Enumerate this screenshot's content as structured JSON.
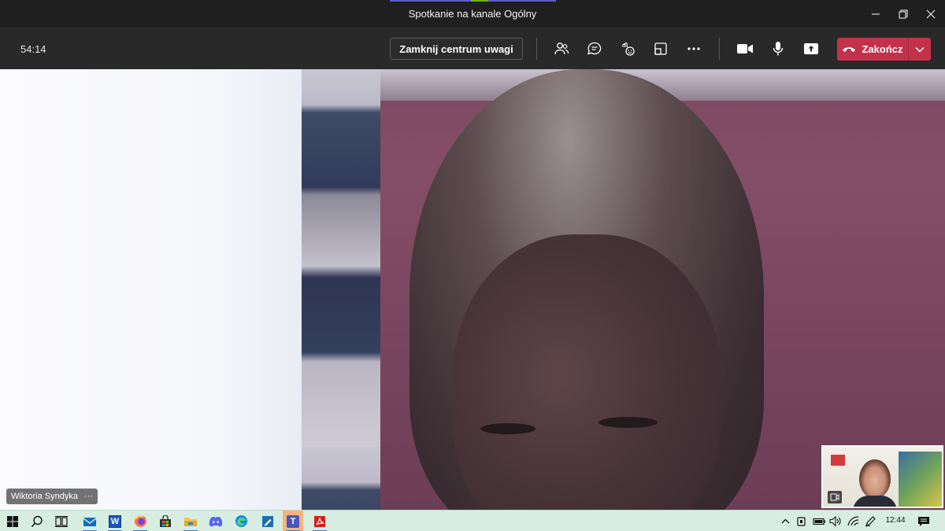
{
  "window": {
    "title": "Spotkanie na kanale Ogólny",
    "minimize_icon": "minimize-icon",
    "maximize_icon": "restore-icon",
    "close_icon": "close-icon"
  },
  "controls": {
    "timer": "54:14",
    "close_spotlight_label": "Zamknij centrum uwagi",
    "icons": [
      "participants-icon",
      "chat-icon",
      "reactions-icon",
      "rooms-icon",
      "more-icon",
      "camera-icon",
      "microphone-icon",
      "share-icon"
    ],
    "end_call_label": "Zakończ",
    "end_call_color": "#c4314b"
  },
  "video": {
    "participant_name": "Wiktoria Syndyka",
    "more_label": "···"
  },
  "taskbar": {
    "apps": [
      "windows-start-icon",
      "search-icon",
      "task-view-icon",
      "mail-icon",
      "word-icon",
      "firefox-icon",
      "store-icon",
      "file-explorer-icon",
      "discord-icon",
      "edge-icon",
      "whiteboard-icon",
      "teams-icon",
      "acrobat-icon"
    ],
    "word_letter": "W",
    "teams_letter": "T",
    "clock": "12:44",
    "accent_color": "#f6b37a"
  }
}
